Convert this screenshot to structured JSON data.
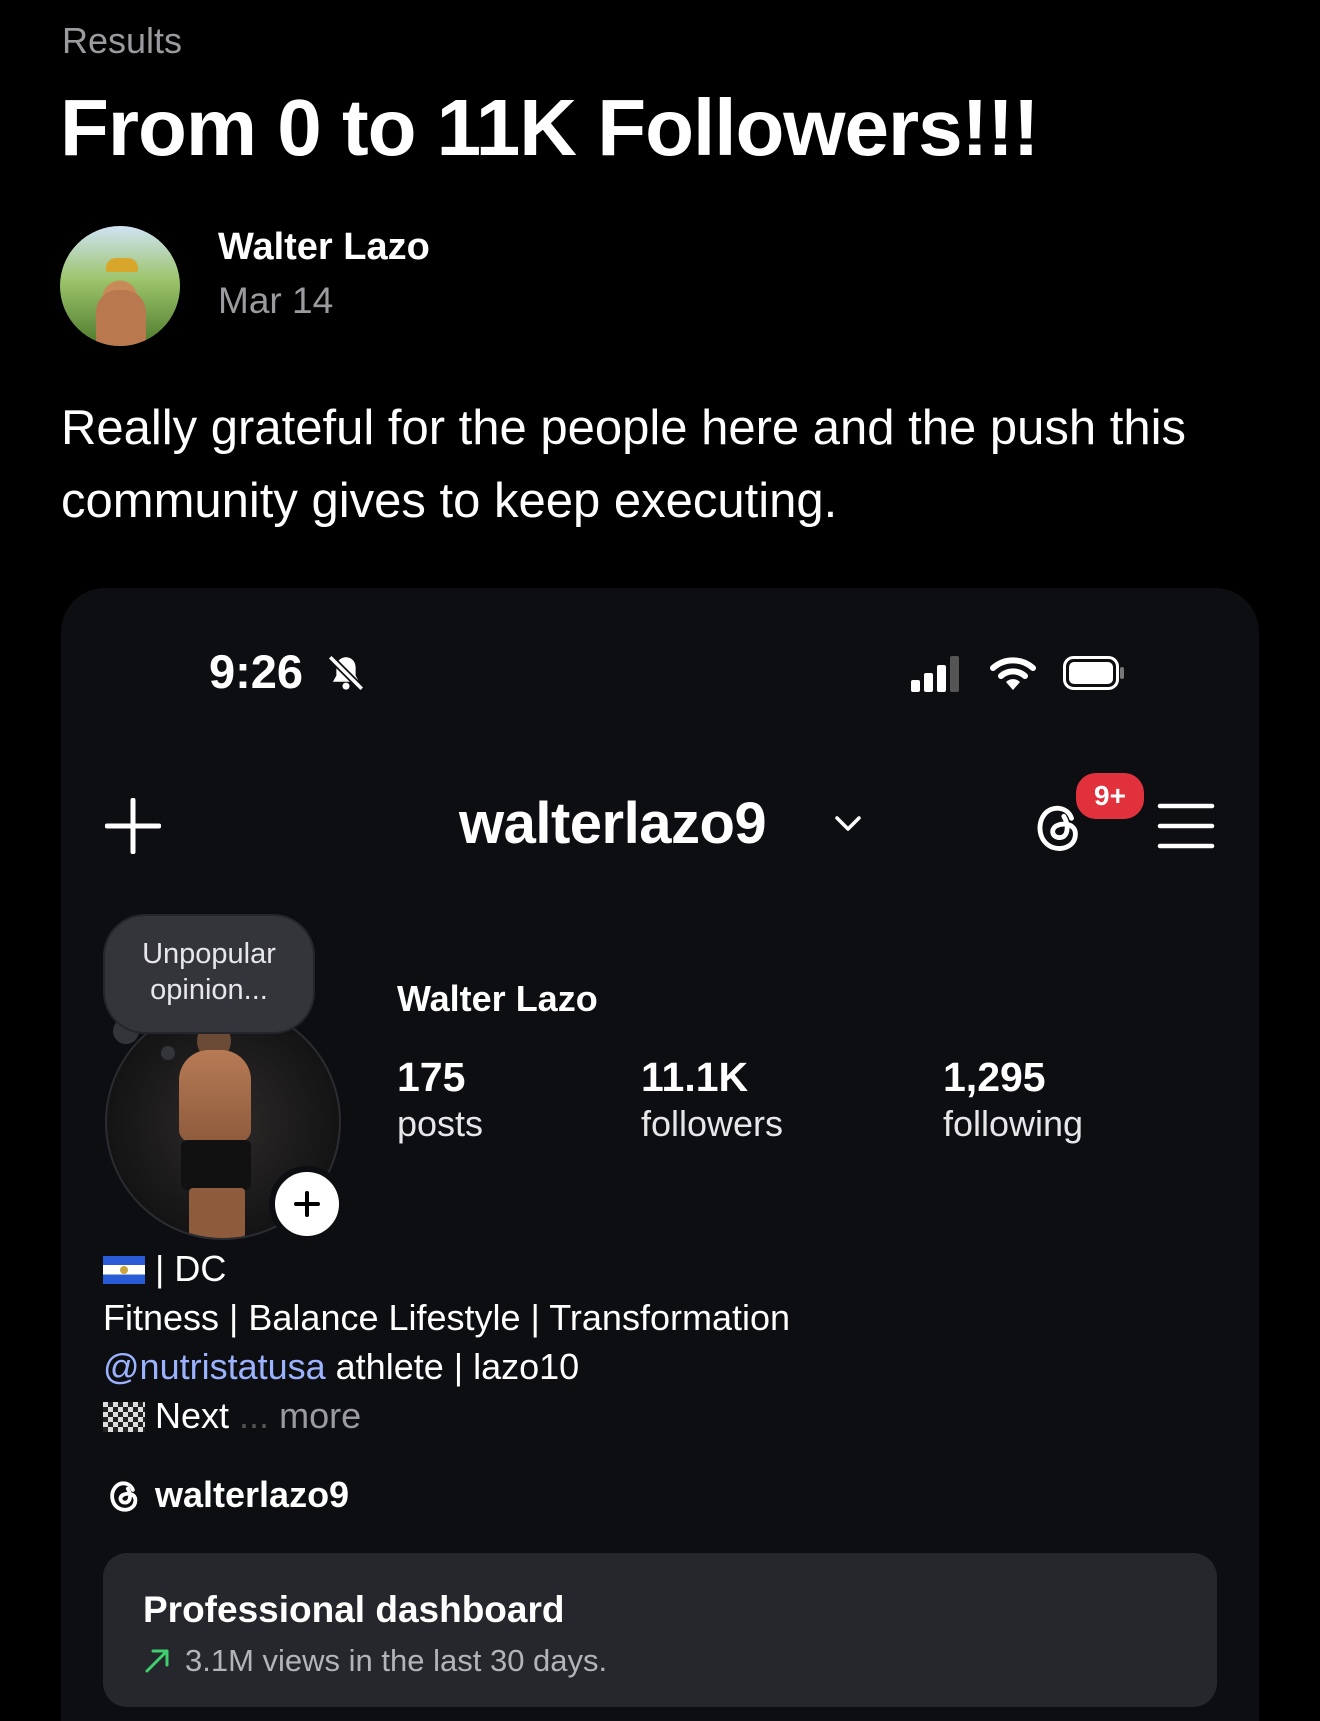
{
  "post": {
    "category": "Results",
    "title": "From 0 to 11K Followers!!!",
    "author": "Walter Lazo",
    "date": "Mar 14",
    "body": "Really grateful for the people here and the push this community gives to keep executing."
  },
  "screenshot": {
    "status_bar": {
      "time": "9:26",
      "icons": [
        "bell-slash-icon",
        "signal-icon",
        "wifi-icon",
        "battery-icon"
      ]
    },
    "header": {
      "username": "walterlazo9",
      "badge": "9+",
      "icons": [
        "plus-icon",
        "chevron-down-icon",
        "threads-icon",
        "menu-icon"
      ]
    },
    "profile": {
      "note": "Unpopular opinion...",
      "display_name": "Walter Lazo",
      "stats": {
        "posts": {
          "value": "175",
          "label": "posts"
        },
        "followers": {
          "value": "11.1K",
          "label": "followers"
        },
        "following": {
          "value": "1,295",
          "label": "following"
        }
      },
      "bio": {
        "line1": "| DC",
        "line2": "Fitness | Balance Lifestyle | Transformation",
        "mention": "@nutristatusa",
        "line3_rest": " athlete | lazo10",
        "line4": "Next",
        "line4_dots": "...",
        "more": "more"
      },
      "threads_handle": "walterlazo9"
    },
    "dashboard": {
      "title": "Professional dashboard",
      "subtitle": "3.1M views in the last 30 days."
    }
  },
  "colors": {
    "background": "#000000",
    "card": "#0d0e12",
    "badge": "#e0313c",
    "mention": "#9bb3ff",
    "dashboard": "#26272c"
  }
}
